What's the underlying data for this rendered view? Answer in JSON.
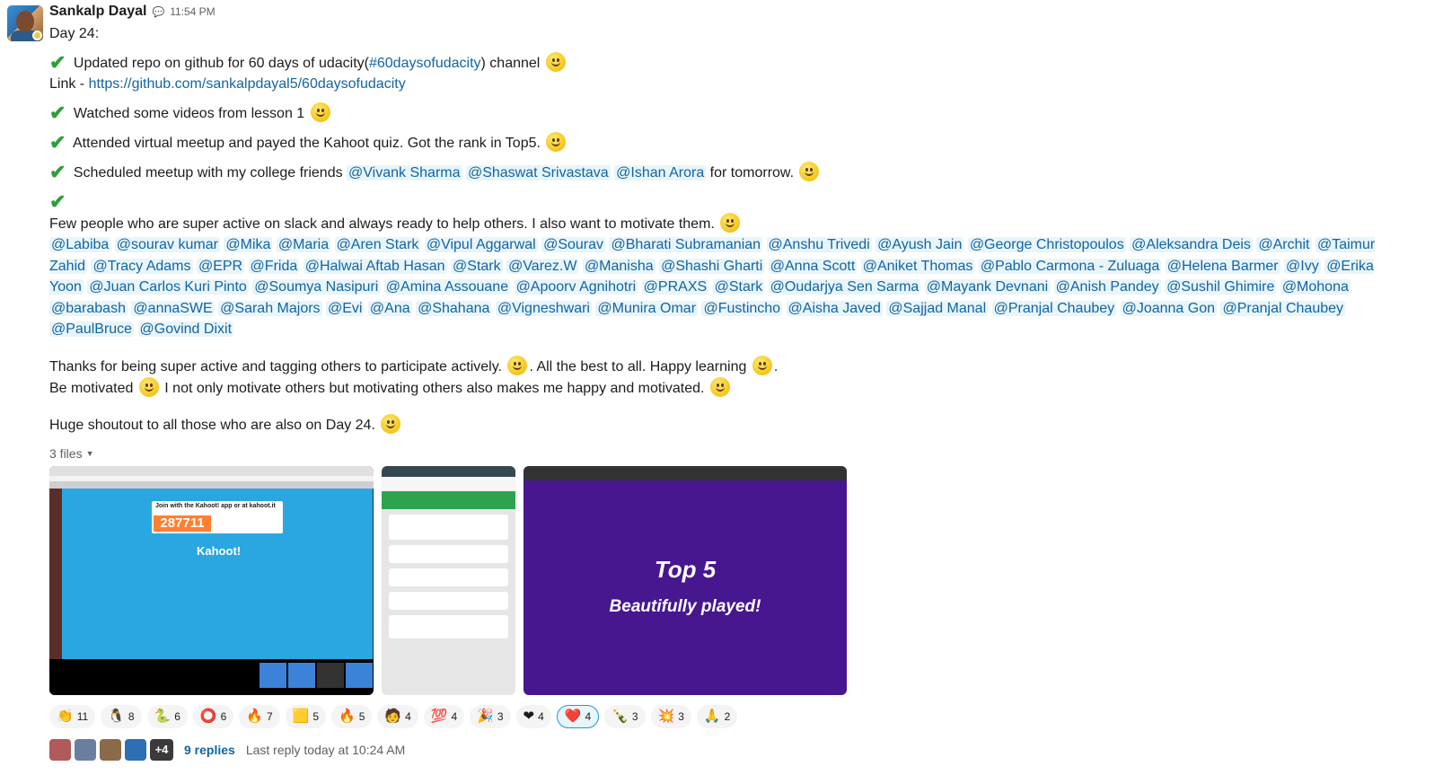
{
  "author": {
    "name": "Sankalp Dayal",
    "time": "11:54 PM"
  },
  "lines": {
    "day": "Day 24:",
    "l1_pre": " Updated repo on github for 60 days of udacity(",
    "l1_channel": "#60daysofudacity",
    "l1_post": ")  channel ",
    "link_prefix": "Link - ",
    "link_url": "https://github.com/sankalpdayal5/60daysofudacity",
    "l2": "  Watched some videos from lesson 1 ",
    "l3": " Attended virtual meetup and payed the Kahoot quiz. Got the rank in Top5. ",
    "l4_pre": "  Scheduled meetup with my college friends ",
    "l4_m1": "@Vivank Sharma",
    "l4_m2": "@Shaswat Srivastava",
    "l4_m3": "@Ishan Arora",
    "l4_post": " for tomorrow. ",
    "l5": "Few people who are super active on slack and always ready to help others. I also want to motivate them. ",
    "l6a": "Thanks for being super active and tagging others to participate actively.  ",
    "l6b": ". All the best to all. Happy learning ",
    "l6c": ".",
    "l7a": "Be motivated ",
    "l7b": " I not only motivate others but motivating others also makes me happy and motivated. ",
    "l8": "Huge shoutout to all those who are also on Day 24. "
  },
  "mentions": [
    "@Labiba",
    "@sourav kumar",
    "@Mika",
    "@Maria",
    "@Aren Stark",
    "@Vipul Aggarwal",
    "@Sourav",
    "@Bharati Subramanian",
    "@Anshu Trivedi",
    "@Ayush Jain",
    "@George Christopoulos",
    "@Aleksandra Deis",
    "@Archit",
    "@Taimur Zahid",
    "@Tracy Adams",
    "@EPR",
    "@Frida",
    "@Halwai Aftab Hasan",
    "@Stark",
    "@Varez.W",
    "@Manisha",
    "@Shashi Gharti",
    "@Anna Scott",
    "@Aniket Thomas",
    "@Pablo Carmona - Zuluaga",
    "@Helena Barmer",
    "@Ivy",
    "@Erika Yoon",
    "@Juan Carlos Kuri Pinto",
    "@Soumya Nasipuri",
    "@Amina Assouane",
    "@Apoorv Agnihotri",
    "@PRAXS",
    "@Stark",
    "@Oudarjya Sen Sarma",
    "@Mayank Devnani",
    "@Anish Pandey",
    "@Sushil Ghimire",
    "@Mohona",
    "@barabash",
    "@annaSWE",
    "@Sarah Majors",
    "@Evi",
    "@Ana",
    "@Shahana",
    "@Vigneshwari",
    "@Munira Omar",
    "@Fustincho",
    "@Aisha Javed",
    "@Sajjad Manal",
    "@Pranjal Chaubey",
    "@Joanna Gon",
    "@Pranjal Chaubey",
    "@PaulBruce",
    "@Govind Dixit"
  ],
  "files": {
    "label": "3 files",
    "kahoot_pin": "287711",
    "kahoot_join": "Join with the Kahoot! app or at kahoot.it",
    "kahoot_logo": "Kahoot!",
    "quiz_title": "Top 5",
    "quiz_sub": "Beautifully played!"
  },
  "reactions": [
    {
      "icon": "clap-icon",
      "glyph": "👏",
      "count": "11"
    },
    {
      "icon": "penguin-icon",
      "glyph": "🐧",
      "count": "8"
    },
    {
      "icon": "python-icon",
      "glyph": "🐍",
      "count": "6"
    },
    {
      "icon": "ring-icon",
      "glyph": "⭕",
      "count": "6"
    },
    {
      "icon": "fire-heart-icon",
      "glyph": "🔥",
      "count": "7"
    },
    {
      "icon": "sticky-note-icon",
      "glyph": "🟨",
      "count": "5"
    },
    {
      "icon": "flame-icon",
      "glyph": "🔥",
      "count": "5"
    },
    {
      "icon": "avatar-icon",
      "glyph": "🧑",
      "count": "4"
    },
    {
      "icon": "hundred-icon",
      "glyph": "💯",
      "count": "4"
    },
    {
      "icon": "party-icon",
      "glyph": "🎉",
      "count": "3"
    },
    {
      "icon": "fire-heart-icon",
      "glyph": "❤",
      "count": "4"
    },
    {
      "icon": "heart-icon",
      "glyph": "❤️",
      "count": "4",
      "active": true
    },
    {
      "icon": "bottle-icon",
      "glyph": "🍾",
      "count": "3"
    },
    {
      "icon": "goku-icon",
      "glyph": "💥",
      "count": "3"
    },
    {
      "icon": "thank-you-icon",
      "glyph": "🙏",
      "count": "2"
    }
  ],
  "thread": {
    "more": "+4",
    "replies": "9 replies",
    "last_reply": "Last reply today at 10:24 AM"
  },
  "colors": {
    "link": "#1264a3",
    "mention_bg": "#e8f5fa",
    "check": "#2e9e3a",
    "kahoot_purple": "#46178f",
    "kahoot_blue": "#2aa7e0"
  }
}
